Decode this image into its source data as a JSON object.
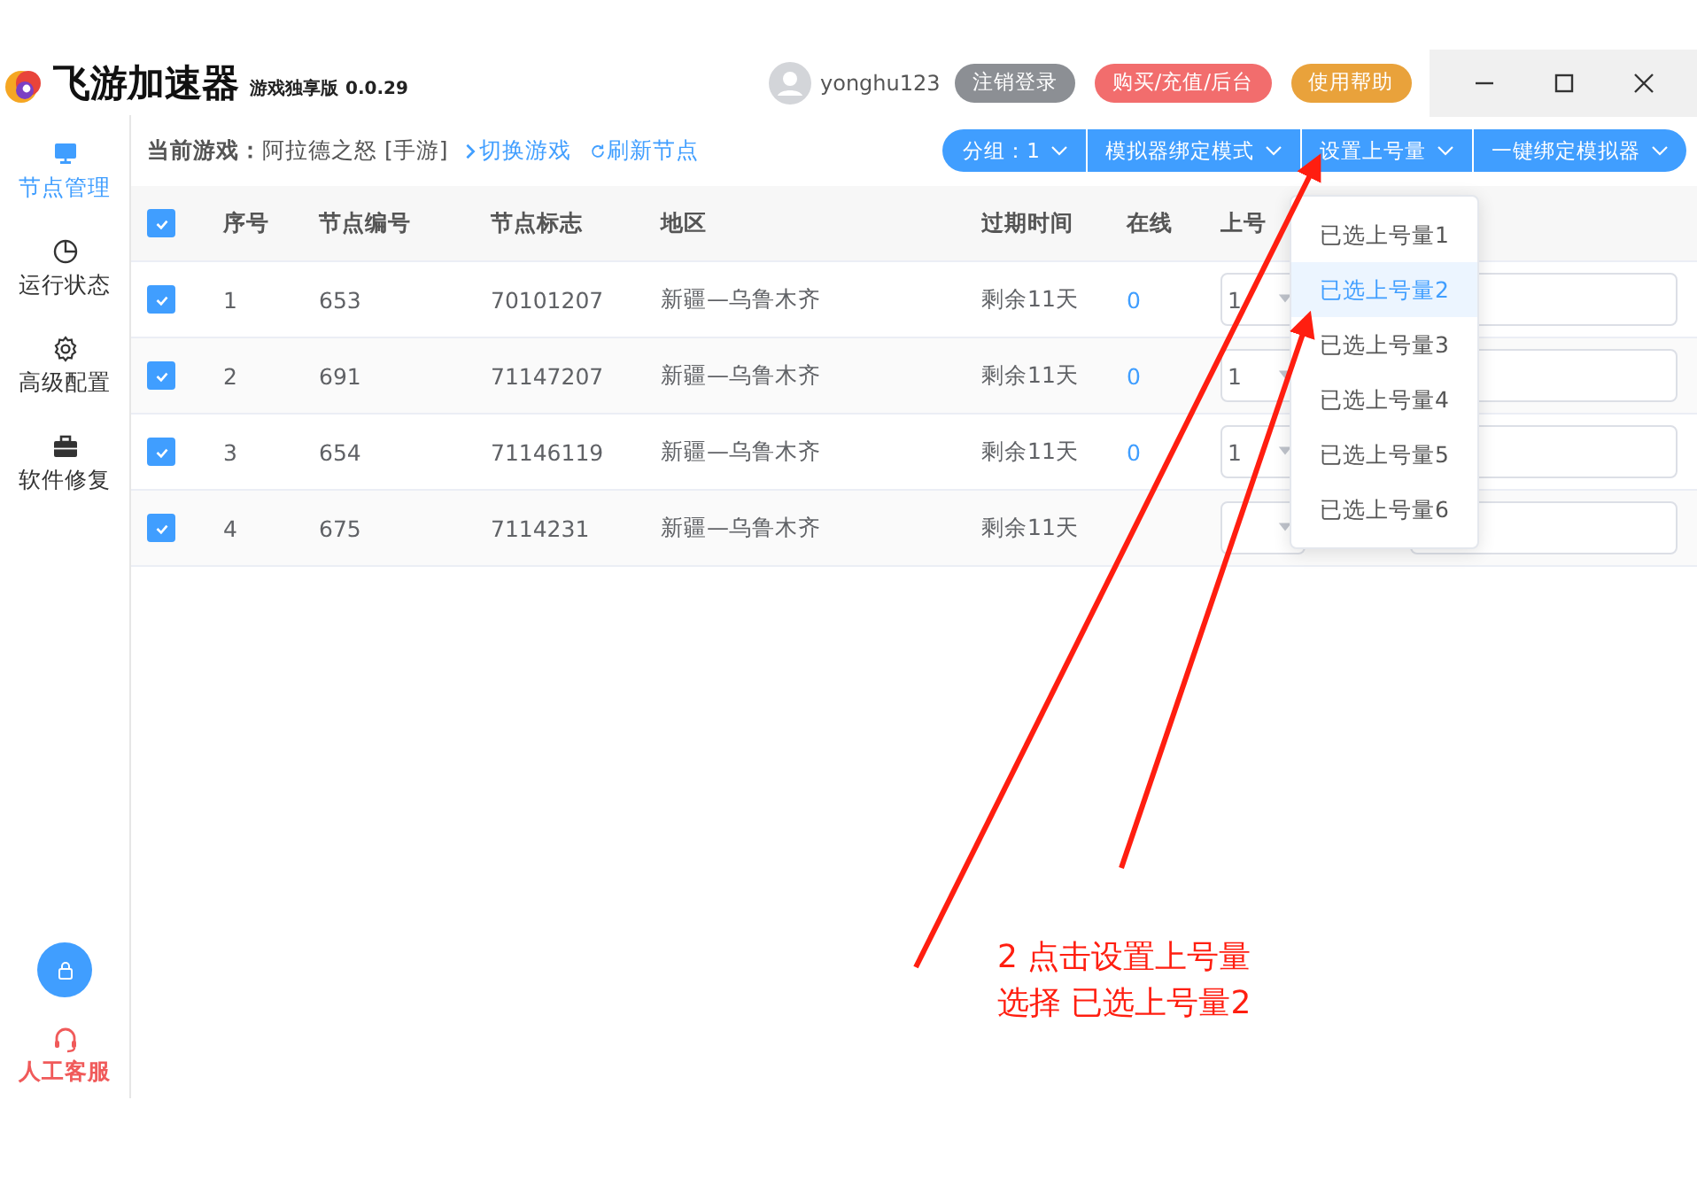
{
  "app": {
    "title": "飞游加速器",
    "edition": "游戏独享版",
    "version": "0.0.29"
  },
  "user": {
    "name": "yonghu123"
  },
  "header_buttons": [
    {
      "label": "注销登录",
      "color": "#8c8f94"
    },
    {
      "label": "购买/充值/后台",
      "color": "#f26d6d"
    },
    {
      "label": "使用帮助",
      "color": "#e9a23b"
    }
  ],
  "sidebar": {
    "items": [
      {
        "label": "节点管理",
        "kind": "monitor",
        "selected": true
      },
      {
        "label": "运行状态",
        "kind": "pie",
        "selected": false
      },
      {
        "label": "高级配置",
        "kind": "gear",
        "selected": false
      },
      {
        "label": "软件修复",
        "kind": "toolbox",
        "selected": false
      }
    ],
    "support": {
      "label": "人工客服"
    }
  },
  "toolbar": {
    "current_game_label": "当前游戏：",
    "current_game": "阿拉德之怒 [手游]",
    "links": [
      {
        "label": "切换游戏",
        "kind": "switch"
      },
      {
        "label": "刷新节点",
        "kind": "refresh"
      }
    ],
    "dropdown_buttons": [
      {
        "label": "分组：1"
      },
      {
        "label": "模拟器绑定模式"
      },
      {
        "label": "设置上号量"
      },
      {
        "label": "一键绑定模拟器"
      }
    ]
  },
  "dropdown_menu": {
    "items": [
      {
        "label": "已选上号量1",
        "selected": false
      },
      {
        "label": "已选上号量2",
        "selected": true
      },
      {
        "label": "已选上号量3",
        "selected": false
      },
      {
        "label": "已选上号量4",
        "selected": false
      },
      {
        "label": "已选上号量5",
        "selected": false
      },
      {
        "label": "已选上号量6",
        "selected": false
      }
    ]
  },
  "table": {
    "header_checked": true,
    "columns": [
      "序号",
      "节点编号",
      "节点标志",
      "地区",
      "过期时间",
      "在线",
      "上号"
    ],
    "rows": [
      {
        "checked": true,
        "cells": [
          "1",
          "653",
          "70101207",
          "新疆—乌鲁木齐",
          "剩余11天"
        ],
        "online": "0",
        "count": "1"
      },
      {
        "checked": true,
        "cells": [
          "2",
          "691",
          "71147207",
          "新疆—乌鲁木齐",
          "剩余11天"
        ],
        "online": "0",
        "count": "1"
      },
      {
        "checked": true,
        "cells": [
          "3",
          "654",
          "71146119",
          "新疆—乌鲁木齐",
          "剩余11天"
        ],
        "online": "0",
        "count": "1"
      },
      {
        "checked": true,
        "cells": [
          "4",
          "675",
          "7114231",
          "新疆—乌鲁木齐",
          "剩余11天"
        ]
      }
    ]
  },
  "annotation": {
    "lines": [
      "2 点击设置上号量",
      "选择 已选上号量2"
    ]
  }
}
